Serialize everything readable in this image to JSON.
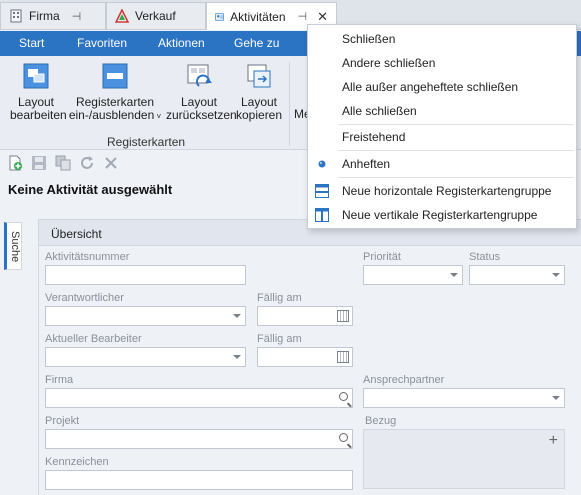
{
  "doc_tabs": [
    {
      "label": "Firma",
      "icon": "building-icon"
    },
    {
      "label": "Verkauf",
      "icon": "triangle-icon"
    },
    {
      "label": "Aktivitäten",
      "icon": "contact-card-icon"
    }
  ],
  "ribbon_tabs": [
    "Start",
    "Favoriten",
    "Aktionen",
    "Gehe zu"
  ],
  "ribbon_buttons": [
    {
      "line1": "Layout",
      "line2": "bearbeiten"
    },
    {
      "line1": "Registerkarten",
      "line2": "ein-/ausblenden"
    },
    {
      "line1": "Layout",
      "line2": "zurücksetzen"
    },
    {
      "line1": "Layout",
      "line2": "kopieren"
    },
    {
      "line1": "Me",
      "line2": ""
    }
  ],
  "ribbon_group": "Registerkarten",
  "title": "Keine Aktivität ausgewählt",
  "side_tab": "Suche",
  "section": "Übersicht",
  "fields": {
    "aktivitaetsnummer": "Aktivitätsnummer",
    "prioritaet": "Priorität",
    "status": "Status",
    "verantwortlicher": "Verantwortlicher",
    "faellig_am_1": "Fällig am",
    "aktueller_bearbeiter": "Aktueller Bearbeiter",
    "faellig_am_2": "Fällig am",
    "firma": "Firma",
    "ansprechpartner": "Ansprechpartner",
    "projekt": "Projekt",
    "bezug": "Bezug",
    "kennzeichen": "Kennzeichen"
  },
  "context_menu": [
    "Schließen",
    "Andere schließen",
    "Alle außer angeheftete schließen",
    "Alle schließen",
    "Freistehend",
    "Anheften",
    "Neue horizontale Registerkartengruppe",
    "Neue vertikale Registerkartengruppe"
  ],
  "colors": {
    "accent": "#2b73c3"
  }
}
